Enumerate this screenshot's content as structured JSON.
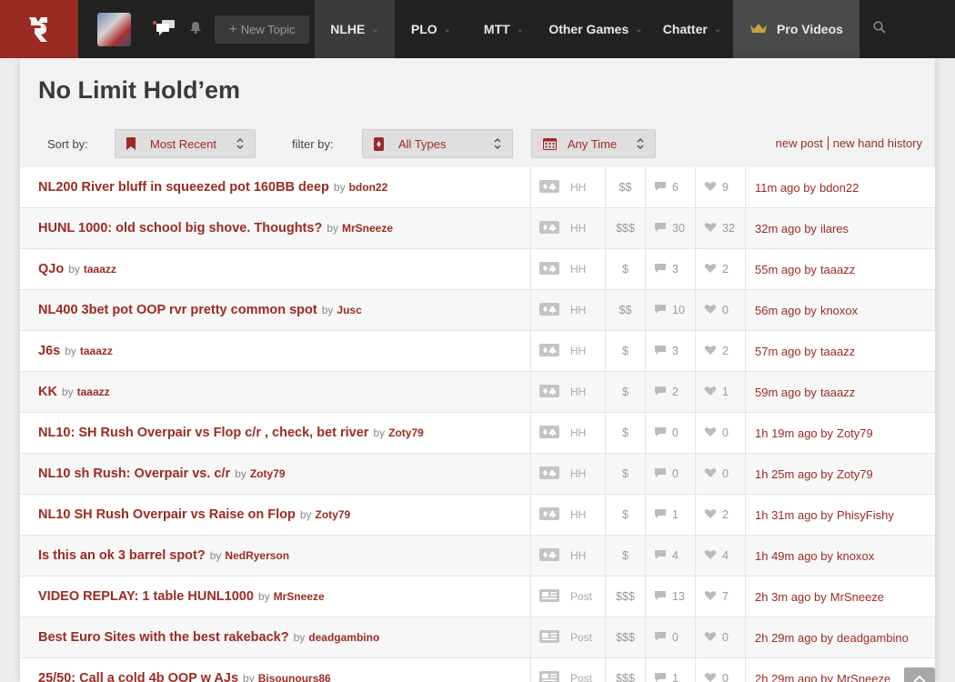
{
  "nav": {
    "new_topic": "New Topic",
    "items": [
      {
        "label": "NLHE"
      },
      {
        "label": "PLO"
      },
      {
        "label": "MTT"
      },
      {
        "label": "Other Games"
      },
      {
        "label": "Chatter"
      }
    ],
    "pro_videos": "Pro Videos",
    "icons": [
      "logo-icon",
      "chat-bubbles-icon",
      "bell-icon",
      "plus-icon",
      "crown-icon",
      "search-icon"
    ]
  },
  "page": {
    "title": "No Limit Hold’em",
    "sort_label": "Sort by:",
    "sort_value": "Most Recent",
    "filter_label": "filter by:",
    "filter_value": "All Types",
    "time_value": "Any Time",
    "new_post": "new post",
    "new_hand_history": "new hand history"
  },
  "colors": {
    "accent": "#9b2b22",
    "nav_bg": "#222222",
    "logo_bg": "#9b2b22"
  },
  "threads": [
    {
      "title": "NL200 River bluff in squeezed pot 160BB deep",
      "by": "by",
      "author": "bdon22",
      "type": "HH",
      "stakes": "$$",
      "replies": "6",
      "likes": "9",
      "last": "11m ago by",
      "last_user": "bdon22"
    },
    {
      "title": "HUNL 1000: old school big shove. Thoughts?",
      "by": "by",
      "author": "MrSneeze",
      "type": "HH",
      "stakes": "$$$",
      "replies": "30",
      "likes": "32",
      "last": "32m ago by",
      "last_user": "ilares"
    },
    {
      "title": "QJo",
      "by": "by",
      "author": "taaazz",
      "type": "HH",
      "stakes": "$",
      "replies": "3",
      "likes": "2",
      "last": "55m ago by",
      "last_user": "taaazz"
    },
    {
      "title": "NL400 3bet pot OOP rvr pretty common spot",
      "by": "by",
      "author": "Jusc",
      "type": "HH",
      "stakes": "$$",
      "replies": "10",
      "likes": "0",
      "last": "56m ago by",
      "last_user": "knoxox"
    },
    {
      "title": "J6s",
      "by": "by",
      "author": "taaazz",
      "type": "HH",
      "stakes": "$",
      "replies": "3",
      "likes": "2",
      "last": "57m ago by",
      "last_user": "taaazz"
    },
    {
      "title": "KK",
      "by": "by",
      "author": "taaazz",
      "type": "HH",
      "stakes": "$",
      "replies": "2",
      "likes": "1",
      "last": "59m ago by",
      "last_user": "taaazz"
    },
    {
      "title": "NL10: SH Rush Overpair vs Flop c/r , check, bet river",
      "by": "by",
      "author": "Zoty79",
      "type": "HH",
      "stakes": "$",
      "replies": "0",
      "likes": "0",
      "last": "1h 19m ago by",
      "last_user": "Zoty79"
    },
    {
      "title": "NL10 sh Rush: Overpair vs. c/r",
      "by": "by",
      "author": "Zoty79",
      "type": "HH",
      "stakes": "$",
      "replies": "0",
      "likes": "0",
      "last": "1h 25m ago by",
      "last_user": "Zoty79"
    },
    {
      "title": "NL10 SH Rush Overpair vs Raise on Flop",
      "by": "by",
      "author": "Zoty79",
      "type": "HH",
      "stakes": "$",
      "replies": "1",
      "likes": "2",
      "last": "1h 31m ago by",
      "last_user": "PhisyFishy"
    },
    {
      "title": "Is this an ok 3 barrel spot?",
      "by": "by",
      "author": "NedRyerson",
      "type": "HH",
      "stakes": "$",
      "replies": "4",
      "likes": "4",
      "last": "1h 49m ago by",
      "last_user": "knoxox"
    },
    {
      "title": "VIDEO REPLAY: 1 table HUNL1000",
      "by": "by",
      "author": "MrSneeze",
      "type": "Post",
      "stakes": "$$$",
      "replies": "13",
      "likes": "7",
      "last": "2h 3m ago by",
      "last_user": "MrSneeze"
    },
    {
      "title": "Best Euro Sites with the best rakeback?",
      "by": "by",
      "author": "deadgambino",
      "type": "Post",
      "stakes": "$$$",
      "replies": "0",
      "likes": "0",
      "last": "2h 29m ago by",
      "last_user": "deadgambino"
    },
    {
      "title": "25/50: Call a cold 4b OOP w AJs",
      "by": "by",
      "author": "Bisounours86",
      "type": "Post",
      "stakes": "$$$",
      "replies": "1",
      "likes": "0",
      "last": "2h 29m ago by",
      "last_user": "MrSneeze"
    }
  ]
}
